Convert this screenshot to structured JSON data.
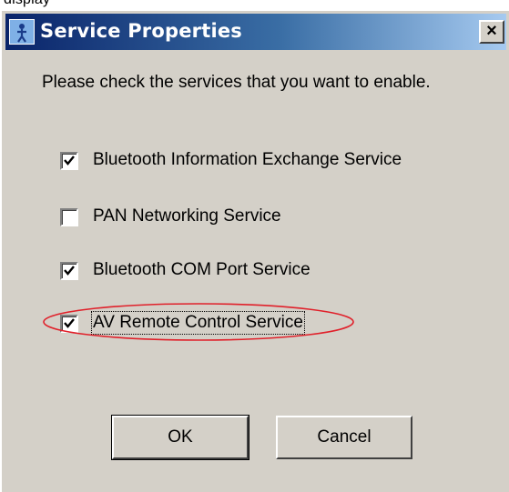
{
  "top_fragment": "display",
  "window": {
    "title": "Service Properties",
    "close_label": "×"
  },
  "prompt": "Please check the services that you want to enable.",
  "services": [
    {
      "label": "Bluetooth Information Exchange Service",
      "checked": true
    },
    {
      "label": "PAN Networking Service",
      "checked": false
    },
    {
      "label": "Bluetooth COM Port Service",
      "checked": true
    },
    {
      "label": "AV Remote Control Service",
      "checked": true,
      "focused": true
    }
  ],
  "buttons": {
    "ok": "OK",
    "cancel": "Cancel"
  },
  "icons": {
    "title": "bluetooth-service-icon",
    "checkmark": "checkmark-icon"
  },
  "colors": {
    "titlebar_start": "#0a246a",
    "titlebar_end": "#a6caf0",
    "dialog_face": "#d4d0c8",
    "annotation": "#e0202a"
  }
}
